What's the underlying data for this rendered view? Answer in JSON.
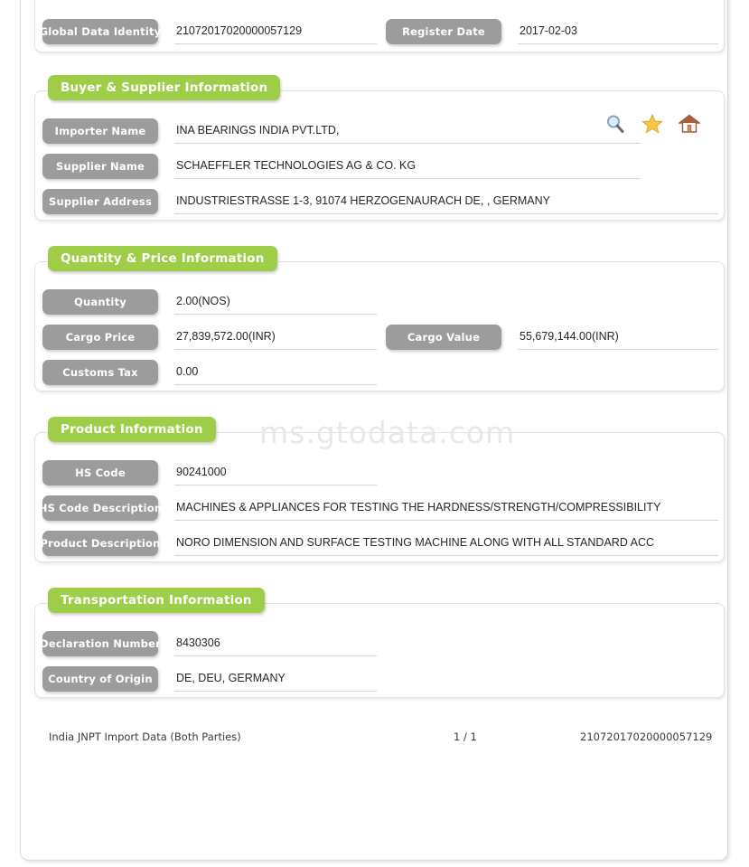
{
  "watermark": "ms.gtodata.com",
  "brand": {
    "green": "#9ecd48",
    "pill_gray": "#9c9c9c"
  },
  "identity_section": {
    "fields": [
      {
        "label": "Global Data Identity",
        "value": "21072017020000057129"
      },
      {
        "label": "Register Date",
        "value": "2017-02-03"
      }
    ]
  },
  "buyer_supplier_section": {
    "title": "Buyer & Supplier Information",
    "fields": [
      {
        "label": "Importer Name",
        "value": "INA BEARINGS INDIA PVT.LTD,"
      },
      {
        "label": "Supplier Name",
        "value": "SCHAEFFLER TECHNOLOGIES AG & CO. KG"
      },
      {
        "label": "Supplier Address",
        "value": "INDUSTRIESTRASSE 1-3, 91074 HERZOGENAURACH DE, , GERMANY"
      }
    ],
    "actions": [
      {
        "name": "search-icon",
        "title": "Search"
      },
      {
        "name": "favorite-icon",
        "title": "Favorite"
      },
      {
        "name": "home-icon",
        "title": "Home"
      }
    ]
  },
  "quantity_price_section": {
    "title": "Quantity & Price Information",
    "fields": [
      {
        "label": "Quantity",
        "value": "2.00(NOS)"
      },
      {
        "label": "Cargo Price",
        "value": "27,839,572.00(INR)"
      },
      {
        "label": "Cargo Value",
        "value": "55,679,144.00(INR)"
      },
      {
        "label": "Customs Tax",
        "value": "0.00"
      }
    ]
  },
  "product_section": {
    "title": "Product Information",
    "fields": [
      {
        "label": "HS Code",
        "value": "90241000"
      },
      {
        "label": "HS Code Description",
        "value": "MACHINES & APPLIANCES FOR TESTING THE HARDNESS/STRENGTH/COMPRESSIBILITY"
      },
      {
        "label": "Product Description",
        "value": "NORO DIMENSION AND SURFACE TESTING MACHINE ALONG WITH ALL STANDARD ACC"
      }
    ]
  },
  "transportation_section": {
    "title": "Transportation Information",
    "fields": [
      {
        "label": "Declaration Number",
        "value": "8430306"
      },
      {
        "label": "Country of Origin",
        "value": "DE, DEU, GERMANY"
      }
    ]
  },
  "footer": {
    "source": "India JNPT Import Data (Both Parties)",
    "page": "1 / 1",
    "record_id": "21072017020000057129"
  }
}
